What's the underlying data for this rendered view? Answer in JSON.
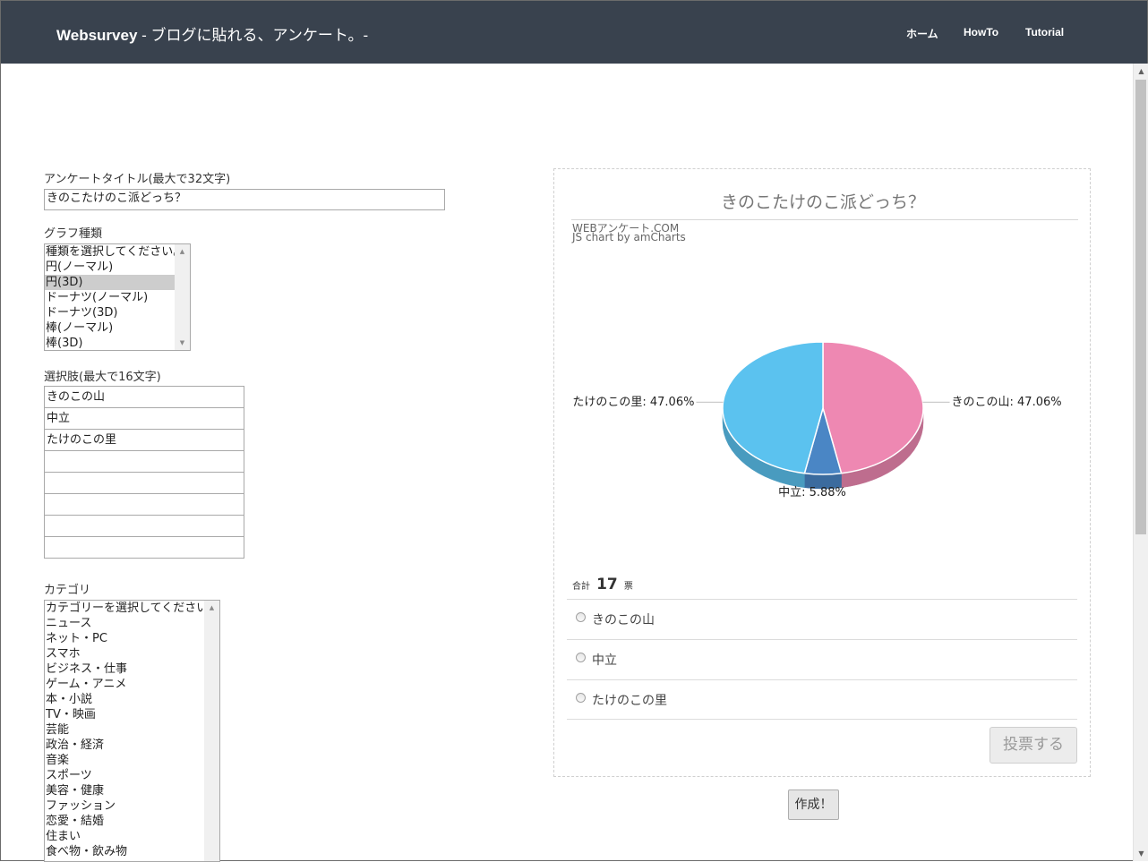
{
  "navbar": {
    "brand_bold": "Websurvey",
    "brand_rest": " - ブログに貼れる、アンケート。-",
    "links": [
      "ホーム",
      "HowTo",
      "Tutorial"
    ]
  },
  "form": {
    "title_label": "アンケートタイトル(最大で32文字)",
    "title_value": "きのこたけのこ派どっち？",
    "graph_label": "グラフ種類",
    "graph_options": [
      "種類を選択してください。",
      "円(ノーマル)",
      "円(3D)",
      "ドーナツ(ノーマル)",
      "ドーナツ(3D)",
      "棒(ノーマル)",
      "棒(3D)"
    ],
    "graph_selected": "円(3D)",
    "choices_label": "選択肢(最大で16文字)",
    "choices": [
      "きのこの山",
      "中立",
      "たけのこの里",
      "",
      "",
      "",
      "",
      ""
    ],
    "category_label": "カテゴリ",
    "category_options": [
      "カテゴリーを選択してください。",
      "ニュース",
      "ネット・PC",
      "スマホ",
      "ビジネス・仕事",
      "ゲーム・アニメ",
      "本・小説",
      "TV・映画",
      "芸能",
      "政治・経済",
      "音楽",
      "スポーツ",
      "美容・健康",
      "ファッション",
      "恋愛・結婚",
      "住まい",
      "食べ物・飲み物"
    ],
    "create_button": "作成！"
  },
  "preview": {
    "credit_line1": "WEBアンケート.COM",
    "credit_line2": "JS chart by amCharts",
    "total_prefix": "合計",
    "total_count": "17",
    "total_suffix": "票",
    "vote_options": [
      "きのこの山",
      "中立",
      "たけのこの里"
    ],
    "vote_button": "投票する"
  },
  "chart_data": {
    "type": "pie",
    "title": "きのこたけのこ派どっち？",
    "style": "3d",
    "slices": [
      {
        "label": "きのこの山",
        "value": 47.06,
        "display": "きのこの山: 47.06%",
        "color": "#ee88b2"
      },
      {
        "label": "中立",
        "value": 5.88,
        "display": "中立: 5.88%",
        "color": "#4a86c5"
      },
      {
        "label": "たけのこの里",
        "value": 47.06,
        "display": "たけのこの里: 47.06%",
        "color": "#5bc2ef"
      }
    ]
  },
  "scrollbar": {
    "up_icon": "scroll-up-arrow-icon",
    "down_icon": "scroll-down-arrow-icon"
  }
}
